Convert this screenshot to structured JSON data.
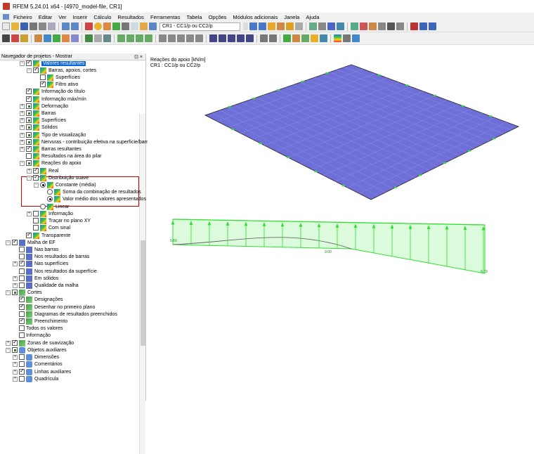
{
  "window": {
    "title": "RFEM 5.24.01 x64 - [4970_model-file, CR1]"
  },
  "menu": [
    "Ficheiro",
    "Editar",
    "Ver",
    "Inserir",
    "Cálculo",
    "Resultados",
    "Ferramentas",
    "Tabela",
    "Opções",
    "Módulos adicionais",
    "Janela",
    "Ajuda"
  ],
  "toolbar": {
    "combo_value": "CR1 - CC1/p ou CC2/p"
  },
  "navigator": {
    "title": "Navegador de projetos - Mostrar",
    "pin": "⊡",
    "close": "×",
    "items": [
      {
        "label": "Valores resultantes",
        "selected": true
      },
      {
        "label": "Barras, apoios, cortes"
      },
      {
        "label": "Superfícies"
      },
      {
        "label": "Filtro ativo"
      },
      {
        "label": "Informação do título"
      },
      {
        "label": "Informação máx/mín"
      },
      {
        "label": "Deformação"
      },
      {
        "label": "Barras"
      },
      {
        "label": "Superfícies"
      },
      {
        "label": "Sólidos"
      },
      {
        "label": "Tipo de visualização"
      },
      {
        "label": "Nervuras - contribuição efetiva na superfície/barra"
      },
      {
        "label": "Barras resultantes"
      },
      {
        "label": "Resultados na área do pilar"
      },
      {
        "label": "Reações do apoio"
      },
      {
        "label": "Real"
      },
      {
        "label": "Distribuição suave"
      },
      {
        "label": "Constante (média)"
      },
      {
        "label": "Soma da combinação de resultados"
      },
      {
        "label": "Valor médio dos valores apresentados"
      },
      {
        "label": "Linear"
      },
      {
        "label": "Informação"
      },
      {
        "label": "Traçar no plano XY"
      },
      {
        "label": "Com sinal"
      },
      {
        "label": "Transparente"
      },
      {
        "label": "Malha de EF"
      },
      {
        "label": "Nas barras"
      },
      {
        "label": "Nos resultados de barras"
      },
      {
        "label": "Nas superfícies"
      },
      {
        "label": "Nos resultados da superfície"
      },
      {
        "label": "Em sólidos"
      },
      {
        "label": "Qualidade da malha"
      },
      {
        "label": "Cortes"
      },
      {
        "label": "Designações"
      },
      {
        "label": "Desenhar no primeiro plano"
      },
      {
        "label": "Diagramas de resultados preenchidos"
      },
      {
        "label": "Preenchimento"
      },
      {
        "label": "Todos os valores"
      },
      {
        "label": "Informação"
      },
      {
        "label": "Zonas de suavização"
      },
      {
        "label": "Objetos auxiliares"
      },
      {
        "label": "Dimensões"
      },
      {
        "label": "Comentários"
      },
      {
        "label": "Linhas auxiliares"
      },
      {
        "label": "Quadrícula"
      }
    ]
  },
  "canvas": {
    "line1": "Reações do apoio [kN/m]",
    "line2": "CR1 : CC1/p ou CC2/p",
    "values": [
      "9.60",
      "9.00",
      "9.79"
    ]
  },
  "colors": {
    "plate": "#6f6fd8",
    "diagram": "#2fe02f",
    "selection": "#0a64d8",
    "highlight_box": "#cc0000"
  }
}
